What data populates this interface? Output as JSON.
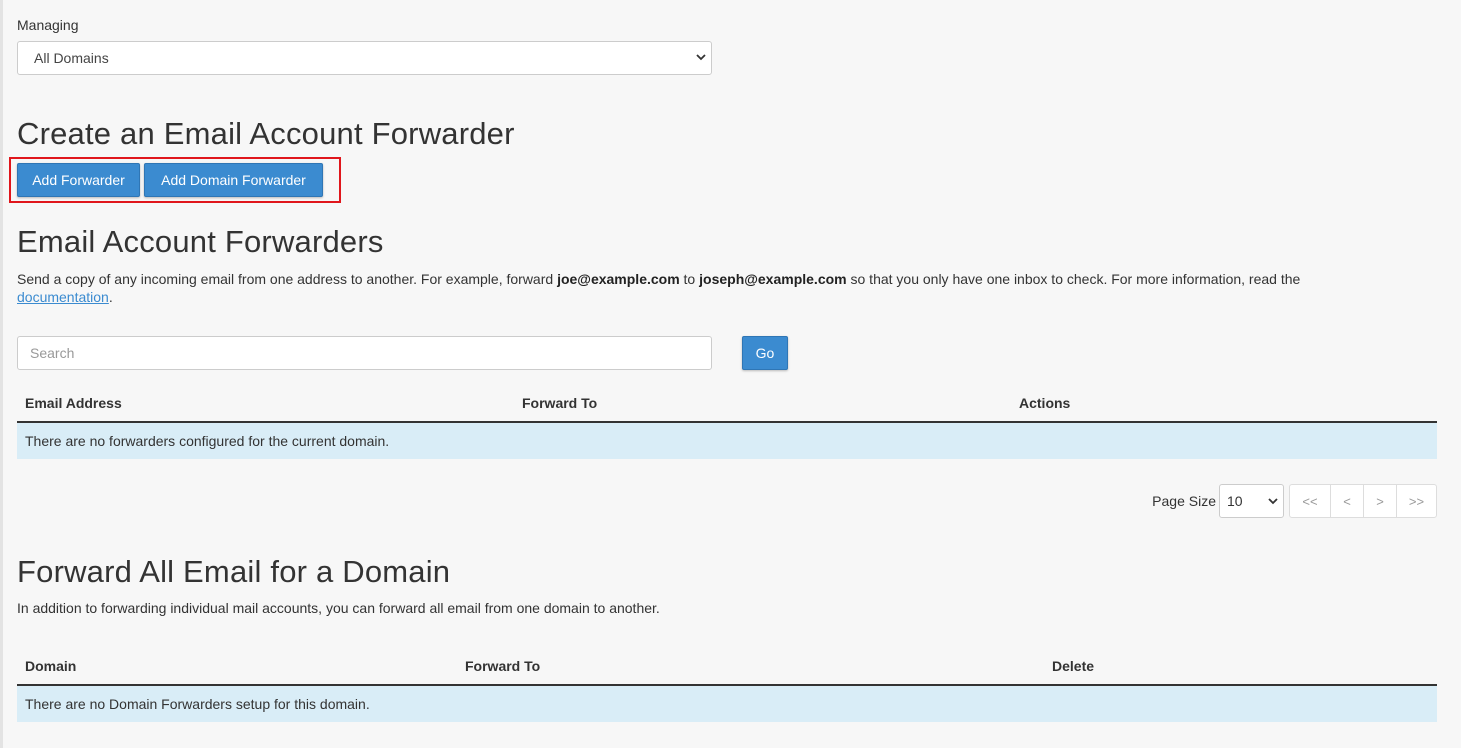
{
  "managing": {
    "label": "Managing",
    "selected": "All Domains"
  },
  "create": {
    "heading": "Create an Email Account Forwarder",
    "add_forwarder_label": "Add Forwarder",
    "add_domain_forwarder_label": "Add Domain Forwarder"
  },
  "forwarders": {
    "heading": "Email Account Forwarders",
    "desc_part1": "Send a copy of any incoming email from one address to another. For example, forward ",
    "desc_email1": "joe@example.com",
    "desc_part2": " to ",
    "desc_email2": "joseph@example.com",
    "desc_part3": " so that you only have one inbox to check. For more information, read the ",
    "desc_link": "documentation",
    "desc_end": ".",
    "search_placeholder": "Search",
    "go_label": "Go",
    "columns": [
      "Email Address",
      "Forward To",
      "Actions"
    ],
    "empty_message": "There are no forwarders configured for the current domain."
  },
  "pagination": {
    "page_size_label": "Page Size",
    "page_size_value": "10",
    "first": "<<",
    "prev": "<",
    "next": ">",
    "last": ">>"
  },
  "domain_forward": {
    "heading": "Forward All Email for a Domain",
    "description": "In addition to forwarding individual mail accounts, you can forward all email from one domain to another.",
    "columns": [
      "Domain",
      "Forward To",
      "Delete"
    ],
    "empty_message": "There are no Domain Forwarders setup for this domain."
  },
  "colors": {
    "primary_button": "#3b8bd0",
    "highlight_border": "#e0161c",
    "empty_row_bg": "#d9edf7",
    "link": "#3b8bd0"
  },
  "icons": {
    "select_arrow": "chevron-down-icon"
  }
}
